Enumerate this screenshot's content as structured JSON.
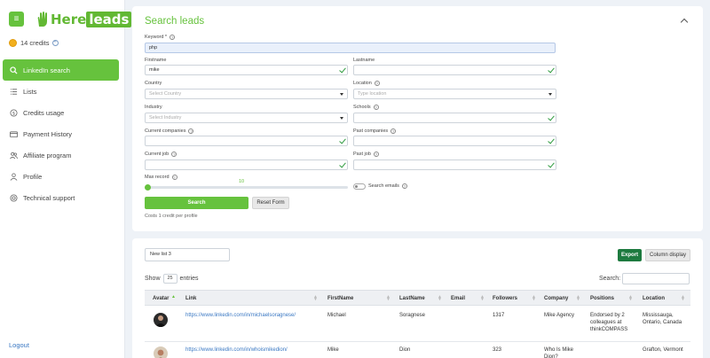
{
  "app": {
    "logo_a": "Here",
    "logo_b": "leads"
  },
  "sidebar": {
    "credits": "14 credits",
    "items": [
      {
        "label": "LinkedIn search",
        "icon": "search-icon"
      },
      {
        "label": "Lists",
        "icon": "list-icon"
      },
      {
        "label": "Credits usage",
        "icon": "dollar-icon"
      },
      {
        "label": "Payment History",
        "icon": "card-icon"
      },
      {
        "label": "Affiliate program",
        "icon": "users-icon"
      },
      {
        "label": "Profile",
        "icon": "user-icon"
      },
      {
        "label": "Technical support",
        "icon": "support-icon"
      }
    ],
    "logout": "Logout"
  },
  "form": {
    "title": "Search leads",
    "keyword_label": "Keyword *",
    "keyword_value": "php",
    "firstname_label": "Firstname",
    "firstname_value": "mike",
    "lastname_label": "Lastname",
    "lastname_value": "",
    "country_label": "Country",
    "country_placeholder": "Select Country",
    "location_label": "Location",
    "location_placeholder": "Type location",
    "industry_label": "Industry",
    "industry_placeholder": "Select Industry",
    "schools_label": "Schools",
    "current_companies_label": "Current companies",
    "past_companies_label": "Past companies",
    "current_job_label": "Current job",
    "past_job_label": "Past job",
    "max_record_label": "Max record",
    "max_record_value": "10",
    "max_record_fraction": 0.0,
    "search_emails_label": "Search emails",
    "search_button": "Search",
    "reset_button": "Reset Form",
    "cost_note": "Costs 1 credit per profile"
  },
  "results": {
    "list_name": "New list 3",
    "export_button": "Export",
    "column_button": "Column display",
    "show_label": "Show",
    "show_value": "25",
    "entries_label": "entries",
    "search_label": "Search:",
    "columns": [
      "Avatar",
      "Link",
      "FirstName",
      "LastName",
      "Email",
      "Followers",
      "Company",
      "Positions",
      "Location"
    ],
    "rows": [
      {
        "link": "https://www.linkedin.com/in/michaelsoragnese/",
        "first": "Michael",
        "last": "Soragnese",
        "email": "",
        "followers": "1317",
        "company": "Mike Agency",
        "positions": "Endorsed by 2 colleagues at thinkCOMPASS",
        "location": "Mississauga, Ontario, Canada"
      },
      {
        "link": "https://www.linkedin.com/in/whoismikedion/",
        "first": "Mike",
        "last": "Dion",
        "email": "",
        "followers": "323",
        "company": "Who Is Mike Dion?",
        "positions": "",
        "location": "Grafton, Vermont"
      }
    ]
  }
}
